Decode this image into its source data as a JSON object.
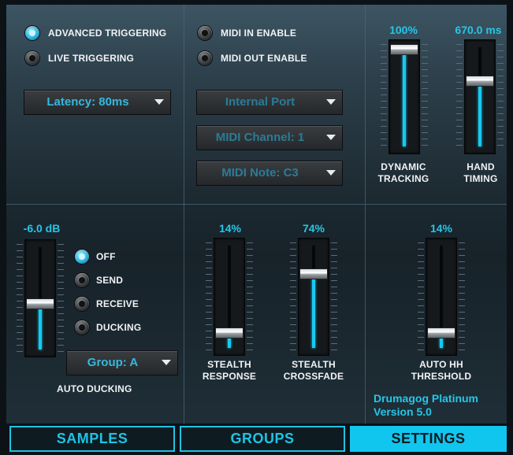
{
  "triggering": {
    "advanced_label": "ADVANCED TRIGGERING",
    "advanced_on": true,
    "live_label": "LIVE TRIGGERING",
    "live_on": false,
    "latency_value": "Latency: 80ms"
  },
  "midi": {
    "in_label": "MIDI IN ENABLE",
    "in_on": false,
    "out_label": "MIDI OUT ENABLE",
    "out_on": false,
    "port_value": "Internal Port",
    "channel_value": "MIDI Channel: 1",
    "note_value": "MIDI Note: C3"
  },
  "dynamic_tracking": {
    "value_text": "100%",
    "label_line1": "DYNAMIC",
    "label_line2": "TRACKING",
    "level": 1.0
  },
  "hand_timing": {
    "value_text": "670.0 ms",
    "label_line1": "HAND",
    "label_line2": "TIMING",
    "level": 0.67
  },
  "auto_ducking": {
    "value_text": "-6.0 dB",
    "level": 0.45,
    "options": [
      "OFF",
      "SEND",
      "RECEIVE",
      "DUCKING"
    ],
    "selected": "OFF",
    "group_value": "Group: A",
    "label": "AUTO DUCKING"
  },
  "stealth_response": {
    "value_text": "14%",
    "label_line1": "STEALTH",
    "label_line2": "RESPONSE",
    "level": 0.14
  },
  "stealth_crossfade": {
    "value_text": "74%",
    "label_line1": "STEALTH",
    "label_line2": "CROSSFADE",
    "level": 0.74
  },
  "auto_hh_threshold": {
    "value_text": "14%",
    "label_line1": "AUTO HH",
    "label_line2": "THRESHOLD",
    "level": 0.14
  },
  "version": {
    "line1": "Drumagog Platinum",
    "line2": "Version 5.0"
  },
  "tabs": [
    {
      "label": "SAMPLES",
      "active": false
    },
    {
      "label": "GROUPS",
      "active": false
    },
    {
      "label": "SETTINGS",
      "active": true
    }
  ],
  "colors": {
    "accent": "#25c6ea",
    "active_tab": "#11c6ee"
  }
}
